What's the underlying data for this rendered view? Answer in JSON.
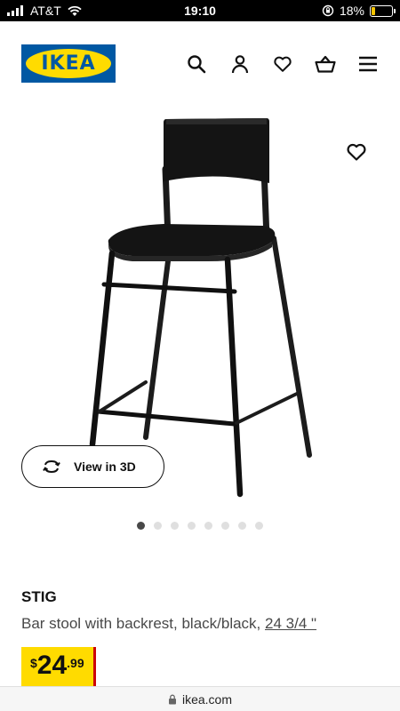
{
  "status_bar": {
    "carrier": "AT&T",
    "time": "19:10",
    "battery_percent": "18%",
    "battery_level": 0.18,
    "battery_color": "#f5c400"
  },
  "header": {
    "logo_text": "IKEA",
    "icons": [
      "search-icon",
      "account-icon",
      "heart-icon",
      "basket-icon",
      "menu-icon"
    ],
    "brand_blue": "#0058a3",
    "brand_yellow": "#ffdb00"
  },
  "gallery": {
    "image_subject": "chair-image",
    "view_3d_label": "View in 3D",
    "dot_count": 8,
    "active_dot": 1
  },
  "product": {
    "name": "STIG",
    "description": "Bar stool with backrest, black/black,",
    "size": "24 3/4 \"",
    "price_currency": "$",
    "price_whole": "24",
    "price_decimal": ".99",
    "price_bg": "#ffdb00",
    "price_accent": "#cc0008"
  },
  "browser": {
    "url": "ikea.com"
  }
}
